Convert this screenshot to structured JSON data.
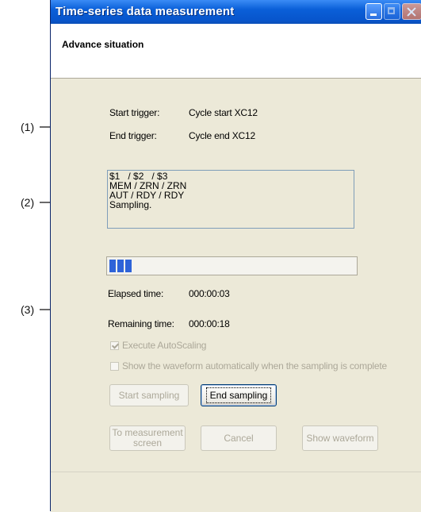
{
  "callouts": [
    "(1)",
    "(2)",
    "(3)"
  ],
  "window": {
    "title": "Time-series data measurement",
    "subtitle": "Advance situation"
  },
  "triggers": {
    "start_label": "Start trigger:",
    "start_value": "Cycle start XC12",
    "end_label": "End trigger:",
    "end_value": "Cycle end XC12"
  },
  "status_lines": [
    "$1   / $2   / $3",
    "MEM / ZRN / ZRN",
    "AUT / RDY / RDY",
    "Sampling."
  ],
  "progress": {
    "blocks_filled": 3,
    "fraction": 0.1,
    "color": "#2e63d8"
  },
  "time": {
    "elapsed_label": "Elapsed time:",
    "elapsed_value": "000:00:03",
    "remaining_label": "Remaining time:",
    "remaining_value": "000:00:18"
  },
  "options": {
    "autoscaling_label": "Execute AutoScaling",
    "autoscaling_checked": true,
    "show_waveform_label": "Show the waveform automatically when the sampling is complete",
    "show_waveform_checked": false
  },
  "buttons": {
    "start_sampling": "Start sampling",
    "end_sampling": "End sampling",
    "to_measurement_line1": "To measurement",
    "to_measurement_line2": "screen",
    "cancel": "Cancel",
    "show_waveform": "Show waveform"
  }
}
